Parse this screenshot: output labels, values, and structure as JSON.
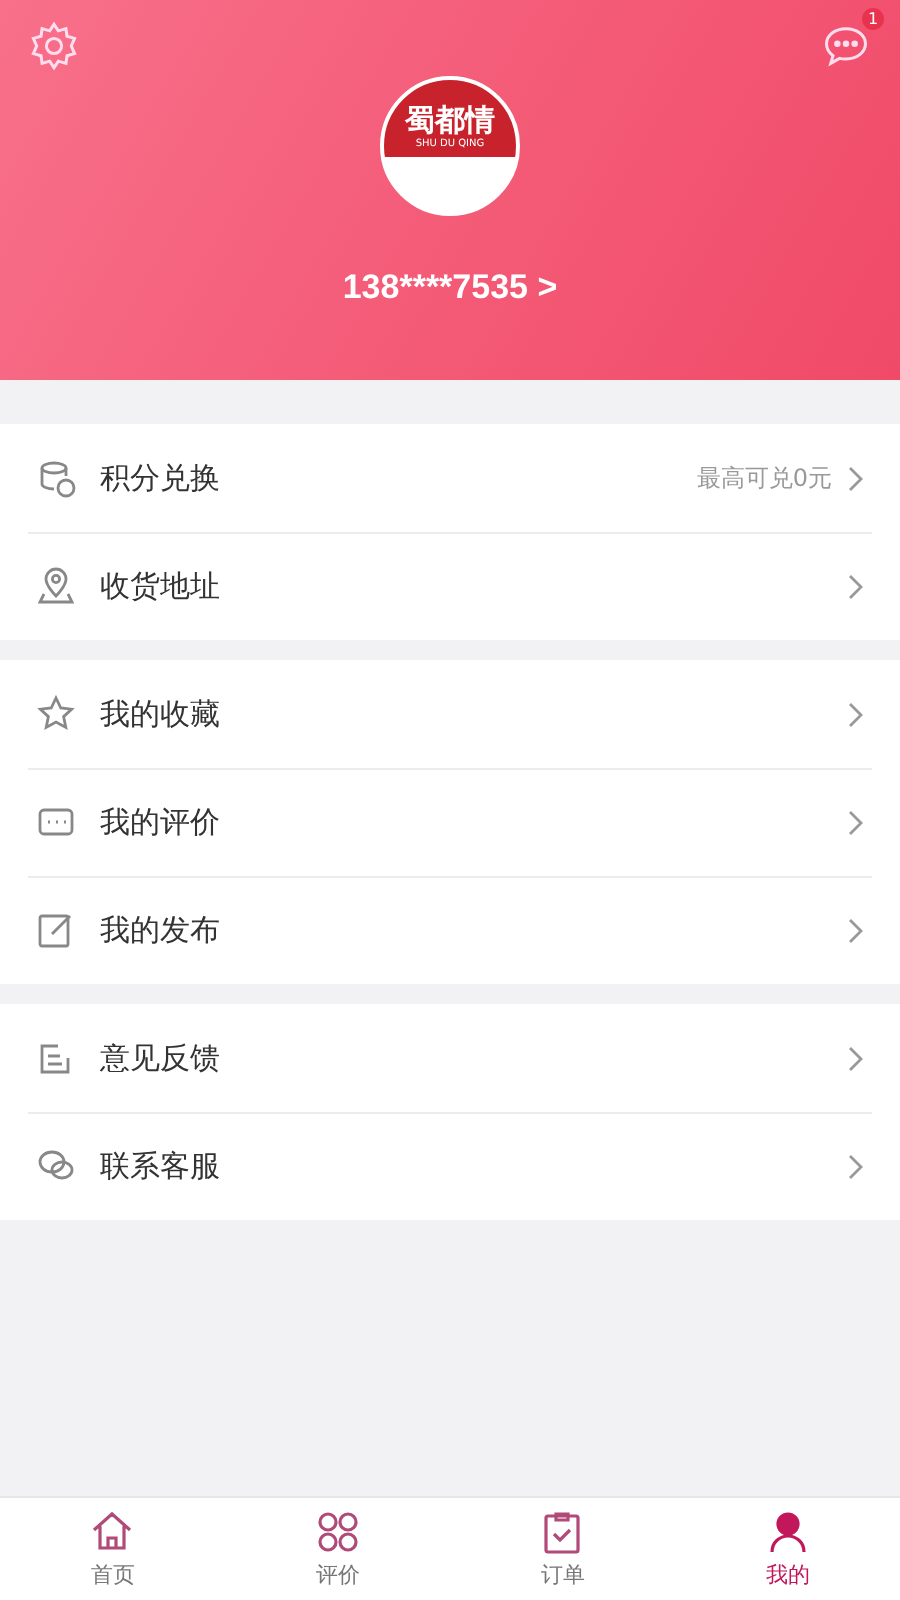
{
  "header": {
    "logo": {
      "title": "蜀都情",
      "subtitle": "SHU DU QING"
    },
    "phone": "138****7535 >",
    "message_badge": "1"
  },
  "groups": [
    {
      "items": [
        {
          "kind": "coins",
          "label": "积分兑换",
          "detail": "最高可兑0元"
        },
        {
          "kind": "pin",
          "label": "收货地址"
        }
      ]
    },
    {
      "items": [
        {
          "kind": "star",
          "label": "我的收藏"
        },
        {
          "kind": "comment",
          "label": "我的评价"
        },
        {
          "kind": "edit",
          "label": "我的发布"
        }
      ]
    },
    {
      "items": [
        {
          "kind": "feedback",
          "label": "意见反馈"
        },
        {
          "kind": "chat",
          "label": "联系客服"
        }
      ]
    }
  ],
  "tabs": [
    {
      "kind": "home",
      "label": "首页",
      "selected": false
    },
    {
      "kind": "grid",
      "label": "评价",
      "selected": false
    },
    {
      "kind": "clipboard",
      "label": "订单",
      "selected": false
    },
    {
      "kind": "user",
      "label": "我的",
      "selected": true
    }
  ]
}
